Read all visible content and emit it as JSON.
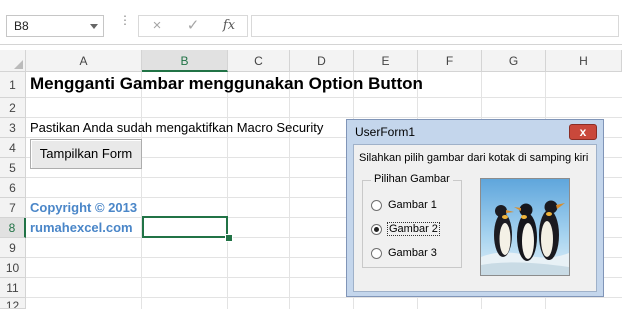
{
  "formula_bar": {
    "name_box": "B8",
    "cancel_icon": "×",
    "enter_icon": "✓",
    "fx_label": "fx",
    "formula_value": ""
  },
  "columns": [
    "A",
    "B",
    "C",
    "D",
    "E",
    "F",
    "G",
    "H"
  ],
  "rows": [
    "1",
    "2",
    "3",
    "4",
    "5",
    "6",
    "7",
    "8",
    "9",
    "10",
    "11",
    "12"
  ],
  "selected_cell": "B8",
  "sheet": {
    "title": "Mengganti Gambar menggunakan Option Button",
    "note": "Pastikan Anda sudah mengaktifkan Macro Security",
    "button_label": "Tampilkan Form",
    "copyright": "Copyright © 2013",
    "site": "rumahexcel.com"
  },
  "userform": {
    "title": "UserForm1",
    "close_icon": "x",
    "instruction": "Silahkan pilih gambar dari kotak di samping kiri",
    "group_caption": "Pilihan Gambar",
    "options": [
      {
        "label": "Gambar 1",
        "selected": false
      },
      {
        "label": "Gambar 2",
        "selected": true
      },
      {
        "label": "Gambar 3",
        "selected": false
      }
    ],
    "image_subject": "penguins"
  },
  "colors": {
    "excel_green": "#217346",
    "copyright_blue": "#4a86c8",
    "close_red": "#c9483b"
  }
}
